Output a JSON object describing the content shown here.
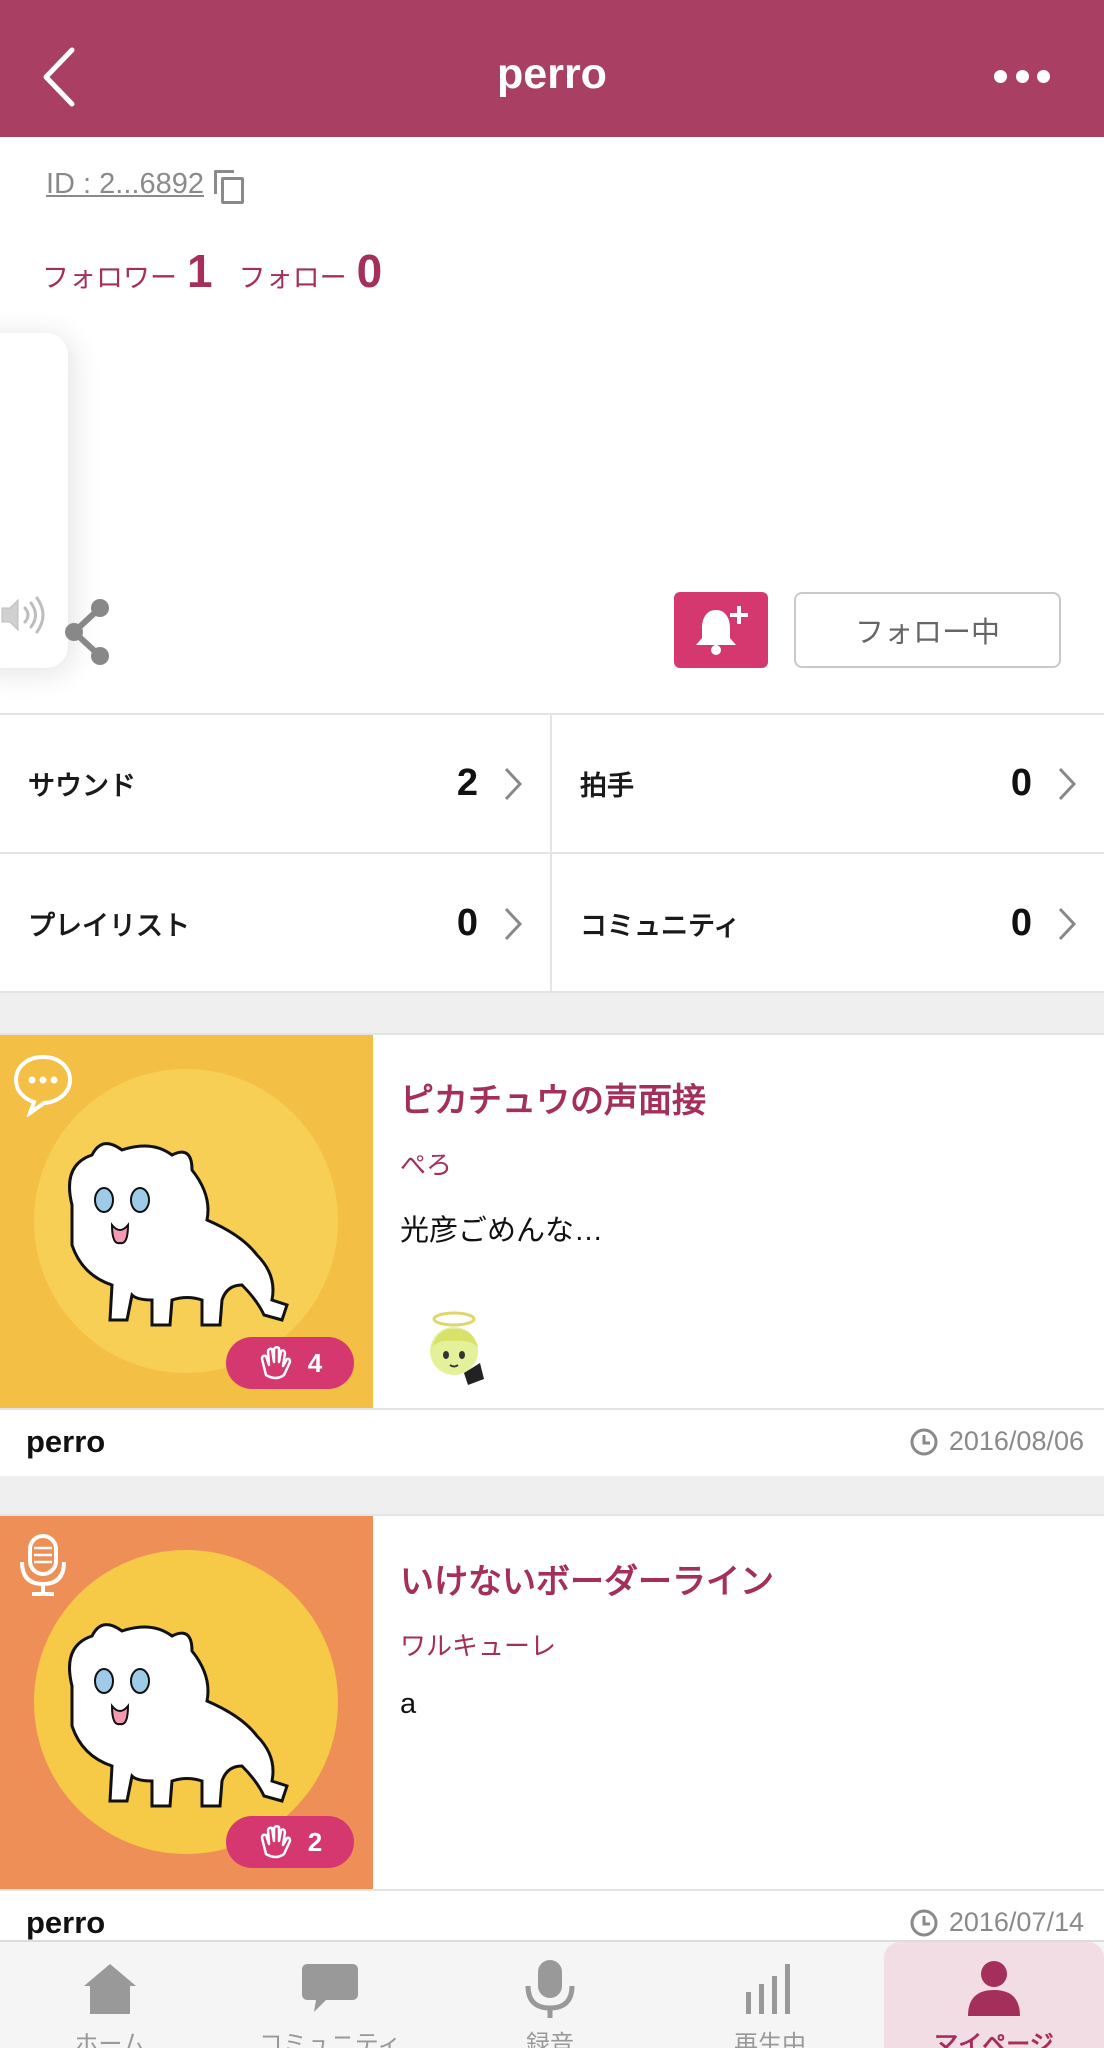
{
  "header": {
    "title": "perro"
  },
  "profile": {
    "user_id": "ID : 2...6892",
    "followers_label": "フォロワー",
    "followers_count": "1",
    "following_label": "フォロー",
    "following_count": "0",
    "follow_button_label": "フォロー中"
  },
  "stats": [
    {
      "label": "サウンド",
      "value": "2"
    },
    {
      "label": "拍手",
      "value": "0"
    },
    {
      "label": "プレイリスト",
      "value": "0"
    },
    {
      "label": "コミュニティ",
      "value": "0"
    }
  ],
  "sounds": [
    {
      "title": "ピカチュウの声面接",
      "artist": "ぺろ",
      "description": "光彦ごめんな…",
      "claps": "4",
      "owner": "perro",
      "date": "2016/08/06",
      "type_icon": "speech-bubble-icon",
      "thumb_bg": "#f3bf45",
      "circle_color": "#f7cf55"
    },
    {
      "title": "いけないボーダーライン",
      "artist": "ワルキューレ",
      "description": "a",
      "claps": "2",
      "owner": "perro",
      "date": "2016/07/14",
      "type_icon": "microphone-icon",
      "thumb_bg": "#ee8f57",
      "circle_color": "#f6c947"
    }
  ],
  "tabs": [
    {
      "label": "ホーム",
      "icon": "home-icon"
    },
    {
      "label": "コミュニティ",
      "icon": "chat-icon"
    },
    {
      "label": "録音",
      "icon": "microphone-icon"
    },
    {
      "label": "再生中",
      "icon": "equalizer-icon"
    },
    {
      "label": "マイページ",
      "icon": "person-icon",
      "active": true
    }
  ],
  "colors": {
    "brand": "#a94064",
    "accent": "#d4386f",
    "text_accent": "#a42f5a"
  }
}
